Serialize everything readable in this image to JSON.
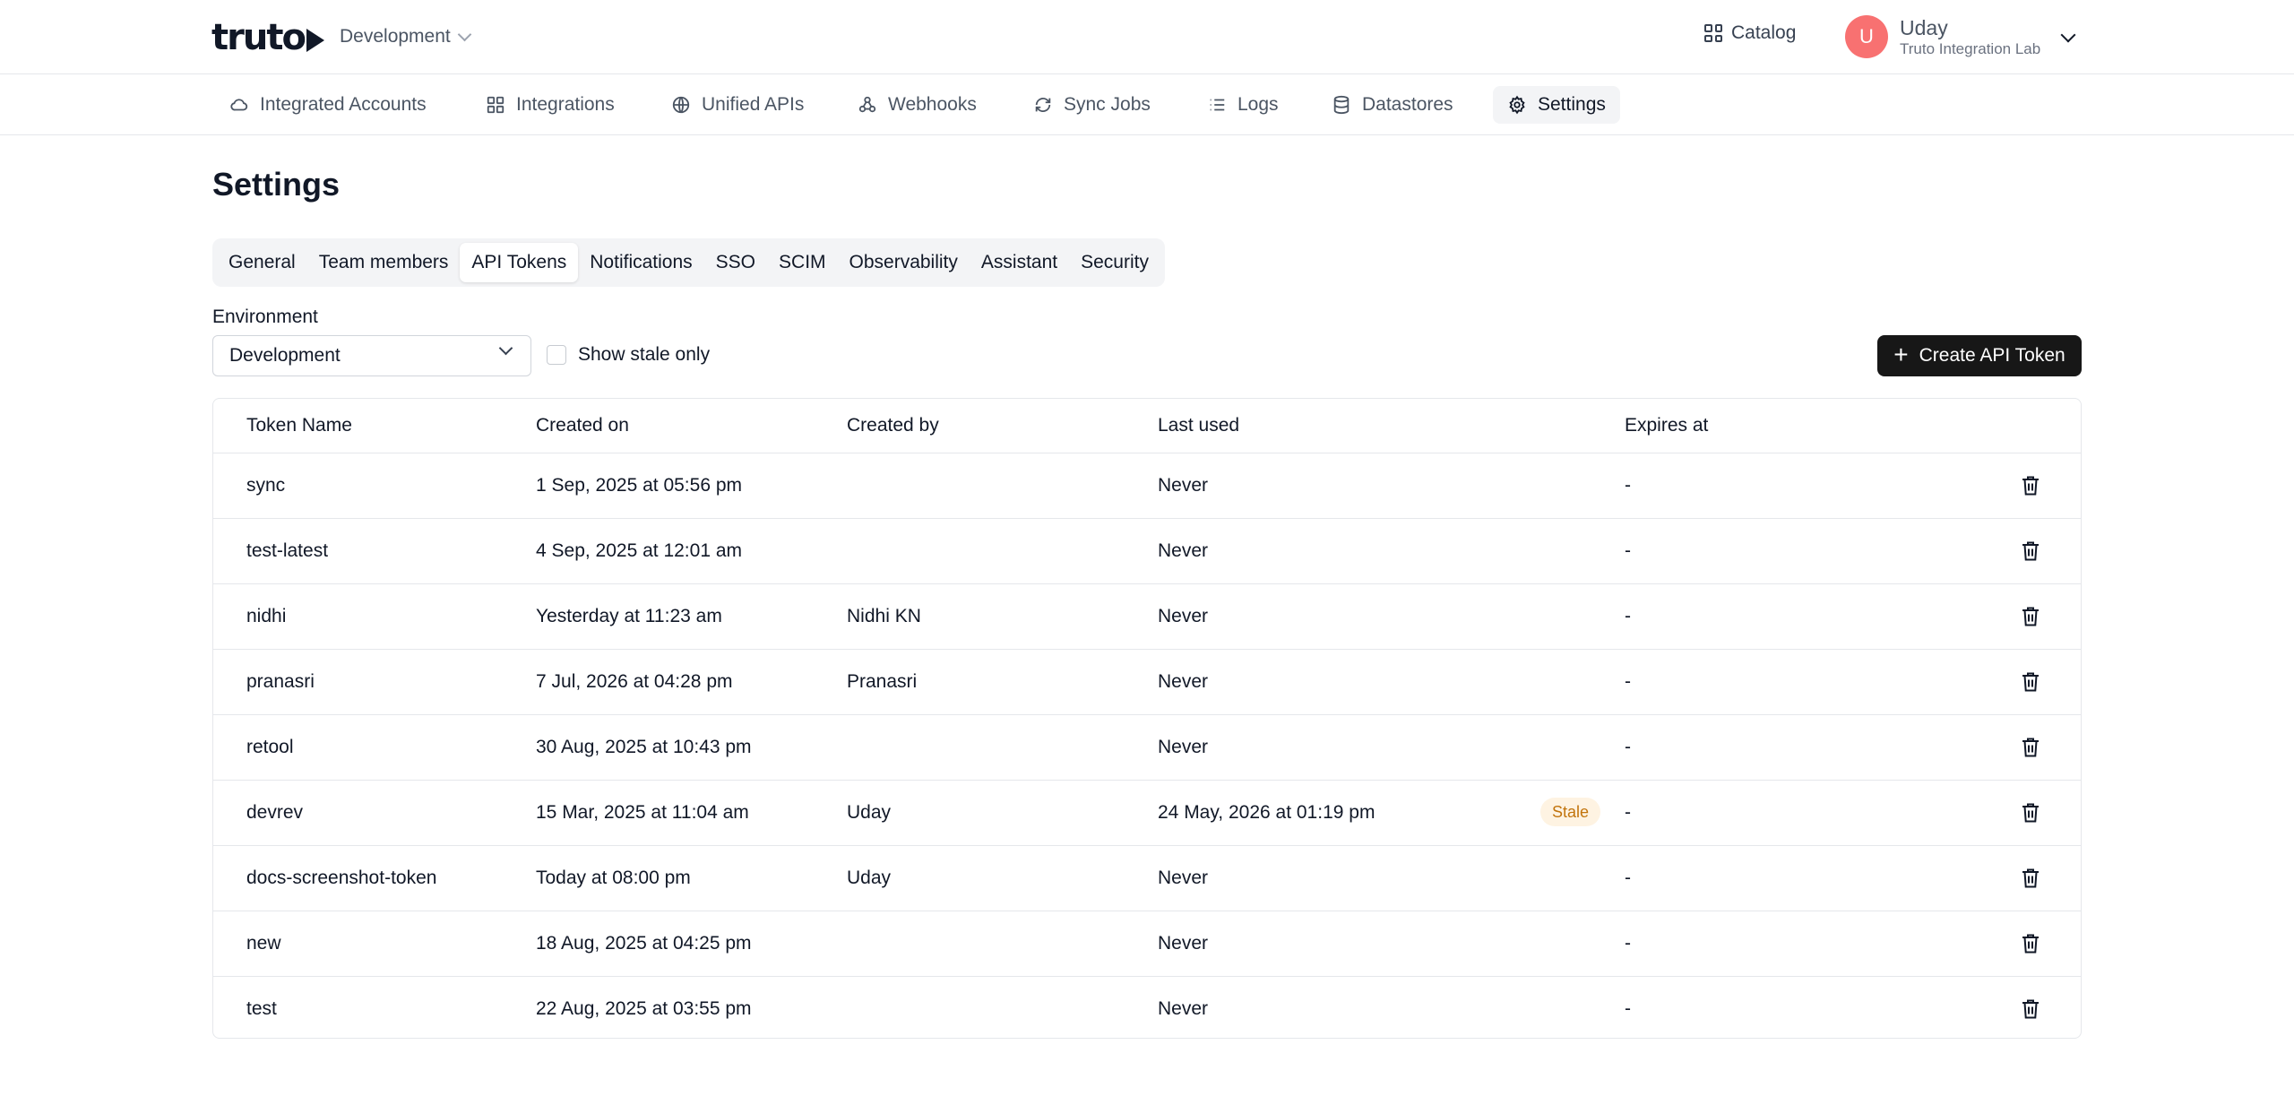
{
  "header": {
    "logo": "truto",
    "environment": "Development",
    "catalog_label": "Catalog",
    "user": {
      "initial": "U",
      "name": "Uday",
      "org": "Truto Integration Lab"
    }
  },
  "nav": [
    {
      "label": "Integrated Accounts",
      "icon": "cloud-icon"
    },
    {
      "label": "Integrations",
      "icon": "grid-icon"
    },
    {
      "label": "Unified APIs",
      "icon": "globe-icon"
    },
    {
      "label": "Webhooks",
      "icon": "webhook-icon"
    },
    {
      "label": "Sync Jobs",
      "icon": "sync-icon"
    },
    {
      "label": "Logs",
      "icon": "list-icon"
    },
    {
      "label": "Datastores",
      "icon": "database-icon"
    },
    {
      "label": "Settings",
      "icon": "gear-icon",
      "active": true
    }
  ],
  "page": {
    "title": "Settings",
    "tabs": [
      "General",
      "Team members",
      "API Tokens",
      "Notifications",
      "SSO",
      "SCIM",
      "Observability",
      "Assistant",
      "Security"
    ],
    "active_tab": "API Tokens",
    "environment_label": "Environment",
    "environment_value": "Development",
    "stale_checkbox_label": "Show stale only",
    "create_button": "Create API Token"
  },
  "table": {
    "columns": [
      "Token Name",
      "Created on",
      "Created by",
      "Last used",
      "Expires at"
    ],
    "rows": [
      {
        "name": "sync",
        "created_on": "1 Sep, 2025 at 05:56 pm",
        "created_by": "",
        "last_used": "Never",
        "stale": "",
        "expires": "-"
      },
      {
        "name": "test-latest",
        "created_on": "4 Sep, 2025 at 12:01 am",
        "created_by": "",
        "last_used": "Never",
        "stale": "",
        "expires": "-"
      },
      {
        "name": "nidhi",
        "created_on": "Yesterday at 11:23 am",
        "created_by": "Nidhi KN",
        "last_used": "Never",
        "stale": "",
        "expires": "-"
      },
      {
        "name": "pranasri",
        "created_on": "7 Jul, 2026 at 04:28 pm",
        "created_by": "Pranasri",
        "last_used": "Never",
        "stale": "",
        "expires": "-"
      },
      {
        "name": "retool",
        "created_on": "30 Aug, 2025 at 10:43 pm",
        "created_by": "",
        "last_used": "Never",
        "stale": "",
        "expires": "-"
      },
      {
        "name": "devrev",
        "created_on": "15 Mar, 2025 at 11:04 am",
        "created_by": "Uday",
        "last_used": "24 May, 2026 at 01:19 pm",
        "stale": "Stale",
        "expires": "-"
      },
      {
        "name": "docs-screenshot-token",
        "created_on": "Today at 08:00 pm",
        "created_by": "Uday",
        "last_used": "Never",
        "stale": "",
        "expires": "-"
      },
      {
        "name": "new",
        "created_on": "18 Aug, 2025 at 04:25 pm",
        "created_by": "",
        "last_used": "Never",
        "stale": "",
        "expires": "-"
      },
      {
        "name": "test",
        "created_on": "22 Aug, 2025 at 03:55 pm",
        "created_by": "",
        "last_used": "Never",
        "stale": "",
        "expires": "-"
      }
    ]
  },
  "colors": {
    "accent": "#171717",
    "avatar": "#f87171",
    "stale_bg": "#fef3e2",
    "stale_text": "#c2740c",
    "border": "#e5e7eb"
  }
}
